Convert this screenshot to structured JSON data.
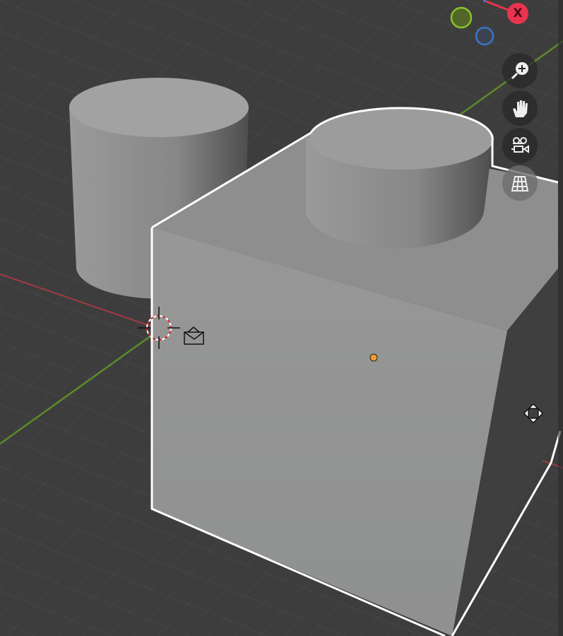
{
  "viewport": {
    "title": "3D Viewport"
  },
  "gizmo": {
    "x_label": "X",
    "x_color": "#e8344f",
    "y_color": "#8bc32a",
    "z_color": "#3b76c6"
  },
  "nav_buttons": [
    {
      "name": "zoom",
      "icon": "zoom-icon"
    },
    {
      "name": "pan",
      "icon": "hand-icon"
    },
    {
      "name": "camera",
      "icon": "camera-icon"
    },
    {
      "name": "ortho",
      "icon": "grid-icon"
    }
  ],
  "colors": {
    "background": "#3d3d3d",
    "selection_outline": "#ffffff",
    "origin": "#f09a2e"
  }
}
